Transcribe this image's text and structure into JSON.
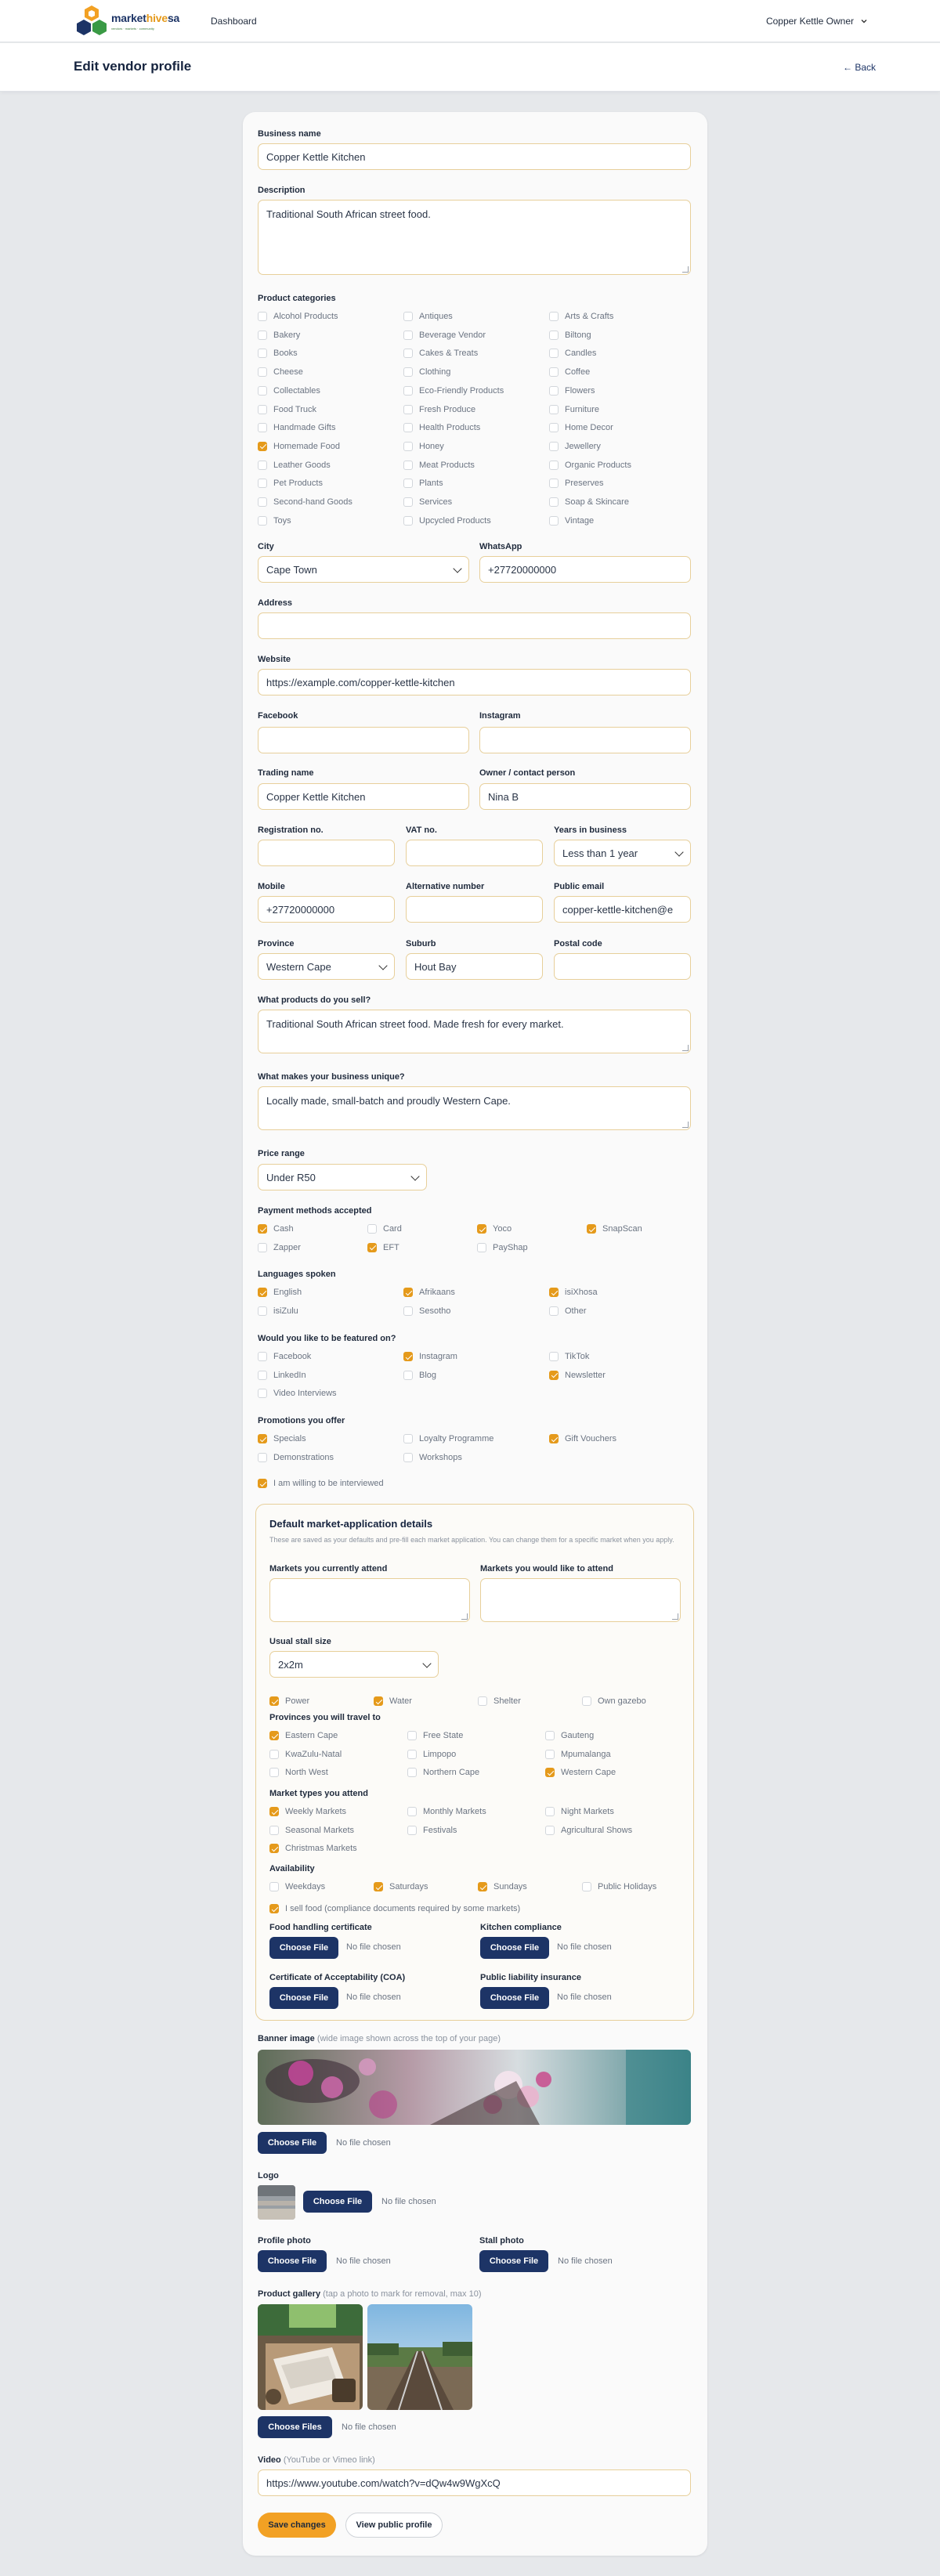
{
  "nav": {
    "brand_main": "market",
    "brand_accent": "hive",
    "brand_suffix": "sa",
    "brand_tagline": "vendors · markets · community",
    "dashboard": "Dashboard",
    "user": "Copper Kettle Owner"
  },
  "header": {
    "title": "Edit vendor profile",
    "back": "← Back"
  },
  "form": {
    "business_name": {
      "label": "Business name",
      "value": "Copper Kettle Kitchen"
    },
    "description": {
      "label": "Description",
      "value": "Traditional South African street food."
    },
    "categories": {
      "label": "Product categories",
      "items": [
        {
          "label": "Alcohol Products",
          "checked": false
        },
        {
          "label": "Antiques",
          "checked": false
        },
        {
          "label": "Arts & Crafts",
          "checked": false
        },
        {
          "label": "Bakery",
          "checked": false
        },
        {
          "label": "Beverage Vendor",
          "checked": false
        },
        {
          "label": "Biltong",
          "checked": false
        },
        {
          "label": "Books",
          "checked": false
        },
        {
          "label": "Cakes & Treats",
          "checked": false
        },
        {
          "label": "Candles",
          "checked": false
        },
        {
          "label": "Cheese",
          "checked": false
        },
        {
          "label": "Clothing",
          "checked": false
        },
        {
          "label": "Coffee",
          "checked": false
        },
        {
          "label": "Collectables",
          "checked": false
        },
        {
          "label": "Eco-Friendly Products",
          "checked": false
        },
        {
          "label": "Flowers",
          "checked": false
        },
        {
          "label": "Food Truck",
          "checked": false
        },
        {
          "label": "Fresh Produce",
          "checked": false
        },
        {
          "label": "Furniture",
          "checked": false
        },
        {
          "label": "Handmade Gifts",
          "checked": false
        },
        {
          "label": "Health Products",
          "checked": false
        },
        {
          "label": "Home Decor",
          "checked": false
        },
        {
          "label": "Homemade Food",
          "checked": true
        },
        {
          "label": "Honey",
          "checked": false
        },
        {
          "label": "Jewellery",
          "checked": false
        },
        {
          "label": "Leather Goods",
          "checked": false
        },
        {
          "label": "Meat Products",
          "checked": false
        },
        {
          "label": "Organic Products",
          "checked": false
        },
        {
          "label": "Pet Products",
          "checked": false
        },
        {
          "label": "Plants",
          "checked": false
        },
        {
          "label": "Preserves",
          "checked": false
        },
        {
          "label": "Second-hand Goods",
          "checked": false
        },
        {
          "label": "Services",
          "checked": false
        },
        {
          "label": "Soap & Skincare",
          "checked": false
        },
        {
          "label": "Toys",
          "checked": false
        },
        {
          "label": "Upcycled Products",
          "checked": false
        },
        {
          "label": "Vintage",
          "checked": false
        }
      ]
    },
    "city": {
      "label": "City",
      "value": "Cape Town"
    },
    "whatsapp": {
      "label": "WhatsApp",
      "value": "+27720000000"
    },
    "address": {
      "label": "Address",
      "value": ""
    },
    "website": {
      "label": "Website",
      "value": "https://example.com/copper-kettle-kitchen"
    },
    "facebook": {
      "label": "Facebook",
      "value": ""
    },
    "instagram": {
      "label": "Instagram",
      "value": ""
    },
    "trading_name": {
      "label": "Trading name",
      "value": "Copper Kettle Kitchen"
    },
    "owner": {
      "label": "Owner / contact person",
      "value": "Nina B"
    },
    "registration": {
      "label": "Registration no.",
      "value": ""
    },
    "vat": {
      "label": "VAT no.",
      "value": ""
    },
    "years": {
      "label": "Years in business",
      "value": "Less than 1 year"
    },
    "mobile": {
      "label": "Mobile",
      "value": "+27720000000"
    },
    "alt_number": {
      "label": "Alternative number",
      "value": ""
    },
    "public_email": {
      "label": "Public email",
      "value": "copper-kettle-kitchen@e"
    },
    "province": {
      "label": "Province",
      "value": "Western Cape"
    },
    "suburb": {
      "label": "Suburb",
      "value": "Hout Bay"
    },
    "postal_code": {
      "label": "Postal code",
      "value": ""
    },
    "products_sell": {
      "label": "What products do you sell?",
      "value": "Traditional South African street food. Made fresh for every market."
    },
    "unique": {
      "label": "What makes your business unique?",
      "value": "Locally made, small-batch and proudly Western Cape."
    },
    "price_range": {
      "label": "Price range",
      "value": "Under R50"
    },
    "payment": {
      "label": "Payment methods accepted",
      "items": [
        {
          "label": "Cash",
          "checked": true
        },
        {
          "label": "Card",
          "checked": false
        },
        {
          "label": "Yoco",
          "checked": true
        },
        {
          "label": "SnapScan",
          "checked": true
        },
        {
          "label": "Zapper",
          "checked": false
        },
        {
          "label": "EFT",
          "checked": true
        },
        {
          "label": "PayShap",
          "checked": false
        }
      ]
    },
    "languages": {
      "label": "Languages spoken",
      "items": [
        {
          "label": "English",
          "checked": true
        },
        {
          "label": "Afrikaans",
          "checked": true
        },
        {
          "label": "isiXhosa",
          "checked": true
        },
        {
          "label": "isiZulu",
          "checked": false
        },
        {
          "label": "Sesotho",
          "checked": false
        },
        {
          "label": "Other",
          "checked": false
        }
      ]
    },
    "featured": {
      "label": "Would you like to be featured on?",
      "items": [
        {
          "label": "Facebook",
          "checked": false
        },
        {
          "label": "Instagram",
          "checked": true
        },
        {
          "label": "TikTok",
          "checked": false
        },
        {
          "label": "LinkedIn",
          "checked": false
        },
        {
          "label": "Blog",
          "checked": false
        },
        {
          "label": "Newsletter",
          "checked": true
        },
        {
          "label": "Video Interviews",
          "checked": false
        }
      ]
    },
    "promotions": {
      "label": "Promotions you offer",
      "items": [
        {
          "label": "Specials",
          "checked": true
        },
        {
          "label": "Loyalty Programme",
          "checked": false
        },
        {
          "label": "Gift Vouchers",
          "checked": true
        },
        {
          "label": "Demonstrations",
          "checked": false
        },
        {
          "label": "Workshops",
          "checked": false
        }
      ]
    },
    "interview": {
      "label": "I am willing to be interviewed",
      "checked": true
    }
  },
  "defaults": {
    "title": "Default market-application details",
    "subtitle": "These are saved as your defaults and pre-fill each market application. You can change them for a specific market when you apply.",
    "current_markets": {
      "label": "Markets you currently attend",
      "value": ""
    },
    "wish_markets": {
      "label": "Markets you would like to attend",
      "value": ""
    },
    "stall_size": {
      "label": "Usual stall size",
      "value": "2x2m"
    },
    "stall_needs": {
      "items": [
        {
          "label": "Power",
          "checked": true
        },
        {
          "label": "Water",
          "checked": true
        },
        {
          "label": "Shelter",
          "checked": false
        },
        {
          "label": "Own gazebo",
          "checked": false
        }
      ]
    },
    "provinces": {
      "label": "Provinces you will travel to",
      "items": [
        {
          "label": "Eastern Cape",
          "checked": true
        },
        {
          "label": "Free State",
          "checked": false
        },
        {
          "label": "Gauteng",
          "checked": false
        },
        {
          "label": "KwaZulu-Natal",
          "checked": false
        },
        {
          "label": "Limpopo",
          "checked": false
        },
        {
          "label": "Mpumalanga",
          "checked": false
        },
        {
          "label": "North West",
          "checked": false
        },
        {
          "label": "Northern Cape",
          "checked": false
        },
        {
          "label": "Western Cape",
          "checked": true
        }
      ]
    },
    "market_types": {
      "label": "Market types you attend",
      "items": [
        {
          "label": "Weekly Markets",
          "checked": true
        },
        {
          "label": "Monthly Markets",
          "checked": false
        },
        {
          "label": "Night Markets",
          "checked": false
        },
        {
          "label": "Seasonal Markets",
          "checked": false
        },
        {
          "label": "Festivals",
          "checked": false
        },
        {
          "label": "Agricultural Shows",
          "checked": false
        },
        {
          "label": "Christmas Markets",
          "checked": true
        }
      ]
    },
    "availability": {
      "label": "Availability",
      "items": [
        {
          "label": "Weekdays",
          "checked": false
        },
        {
          "label": "Saturdays",
          "checked": true
        },
        {
          "label": "Sundays",
          "checked": true
        },
        {
          "label": "Public Holidays",
          "checked": false
        }
      ]
    },
    "sell_food": {
      "label": "I sell food (compliance documents required by some markets)",
      "checked": true
    },
    "food_cert": {
      "label": "Food handling certificate"
    },
    "kitchen": {
      "label": "Kitchen compliance"
    },
    "coa": {
      "label": "Certificate of Acceptability (COA)"
    },
    "liability": {
      "label": "Public liability insurance"
    }
  },
  "files": {
    "choose_file": "Choose File",
    "choose_files": "Choose Files",
    "no_file": "No file chosen",
    "banner_label": "Banner image",
    "banner_hint": "(wide image shown across the top of your page)",
    "logo_label": "Logo",
    "profile_label": "Profile photo",
    "stall_label": "Stall photo",
    "gallery_label": "Product gallery",
    "gallery_hint": "(tap a photo to mark for removal, max 10)"
  },
  "video": {
    "label": "Video",
    "hint": "(YouTube or Vimeo link)",
    "value": "https://www.youtube.com/watch?v=dQw4w9WgXcQ"
  },
  "actions": {
    "save": "Save changes",
    "view": "View public profile"
  },
  "colors": {
    "accent": "#e59a1b",
    "navy": "#1d3466",
    "border": "#e7cf9a"
  }
}
